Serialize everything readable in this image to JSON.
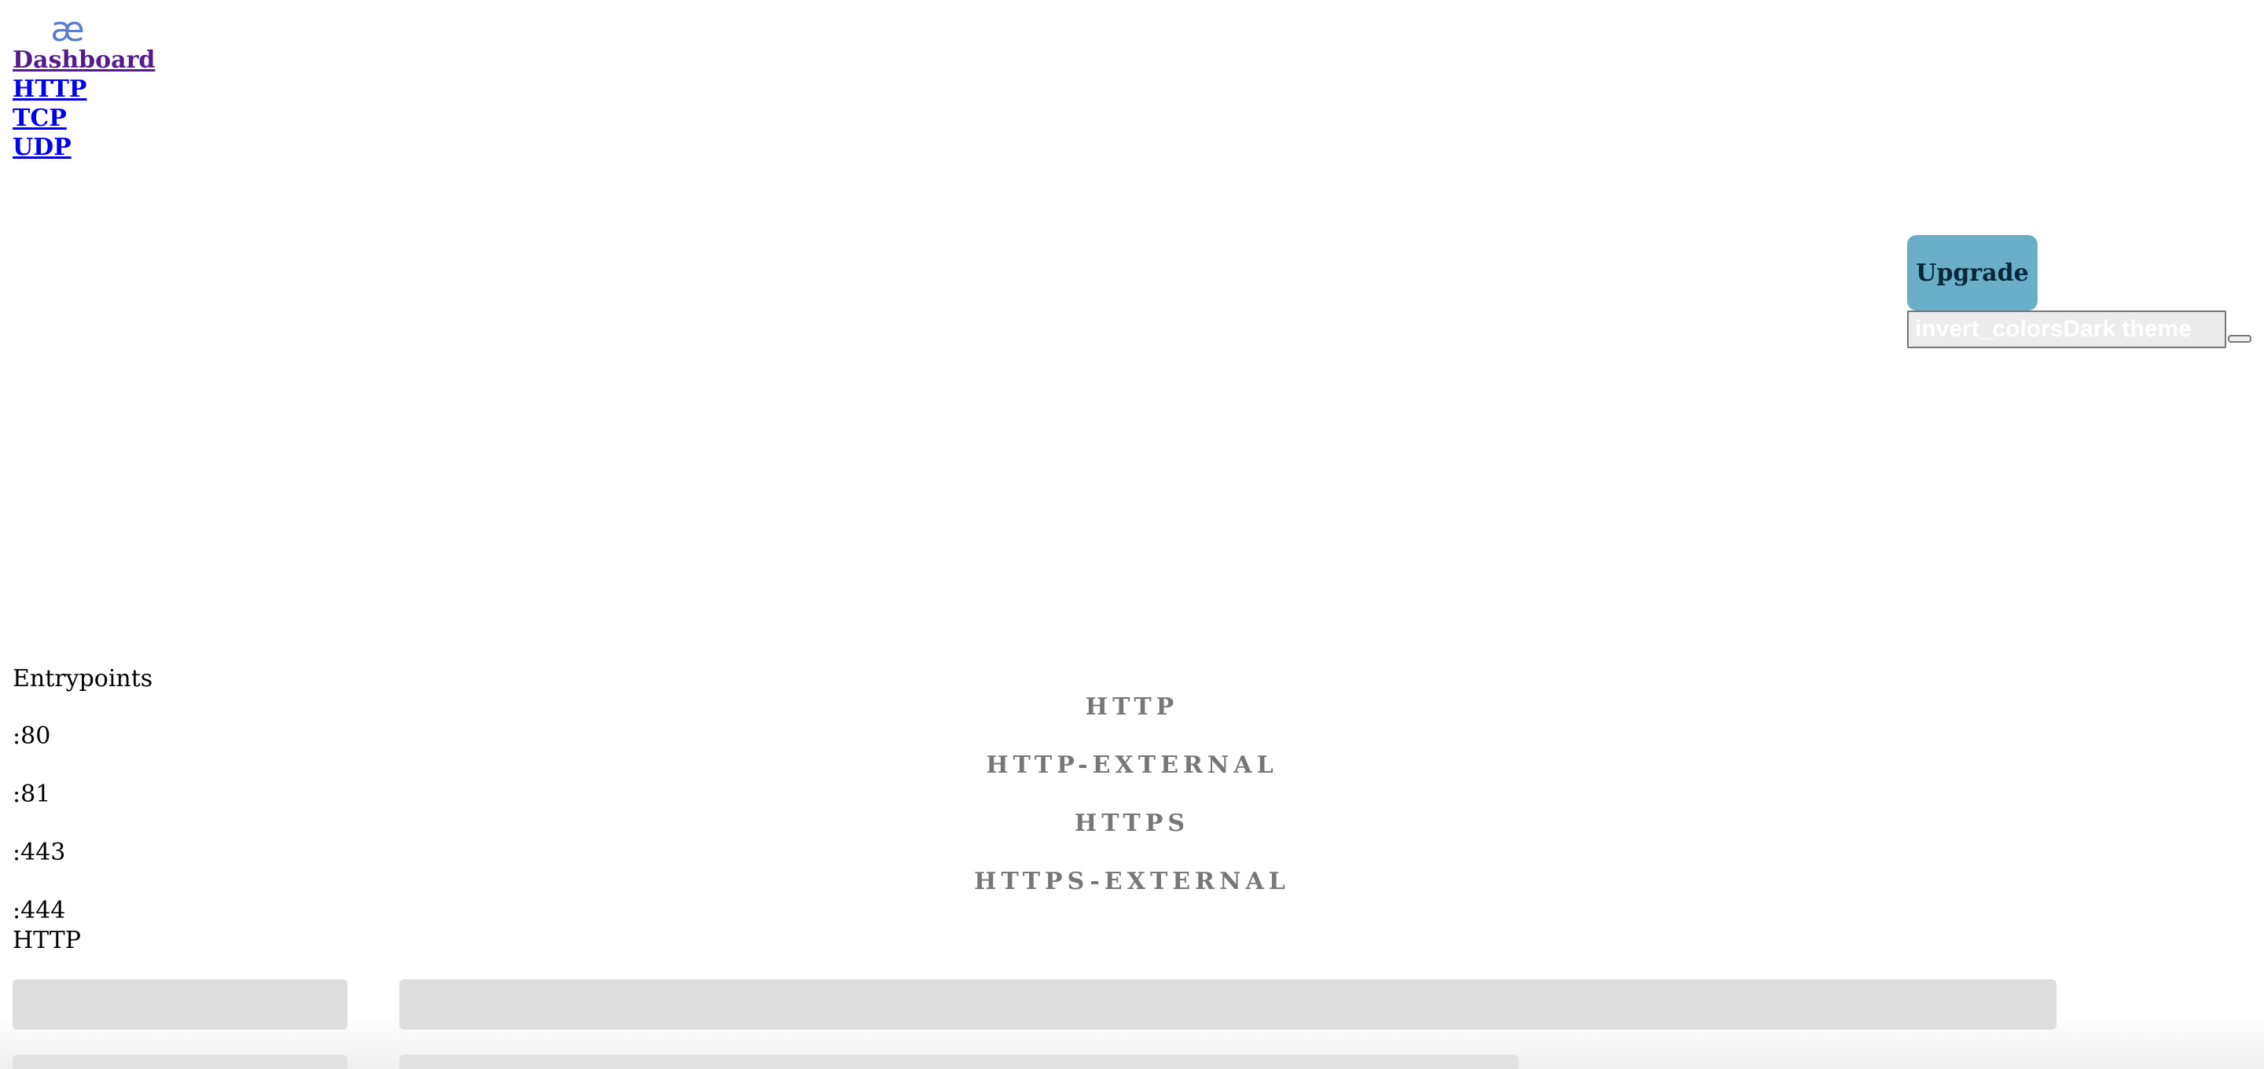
{
  "logo": {
    "glyph": "æ",
    "color": "#5b7bd8"
  },
  "nav": {
    "items": [
      {
        "label": "Dashboard"
      },
      {
        "label": "HTTP"
      },
      {
        "label": "TCP"
      },
      {
        "label": "UDP"
      }
    ]
  },
  "header": {
    "upgrade_label": "Upgrade",
    "theme_toggle_label": "invert_colorsDark theme",
    "accent_color": "#6aaec8"
  },
  "entrypoints": {
    "heading": "Entrypoints",
    "ports": [
      ":80",
      ":81",
      ":443",
      ":444"
    ],
    "names": [
      "HTTP",
      "HTTP-EXTERNAL",
      "HTTPS",
      "HTTPS-EXTERNAL"
    ]
  },
  "http_section": {
    "title": "HTTP"
  }
}
